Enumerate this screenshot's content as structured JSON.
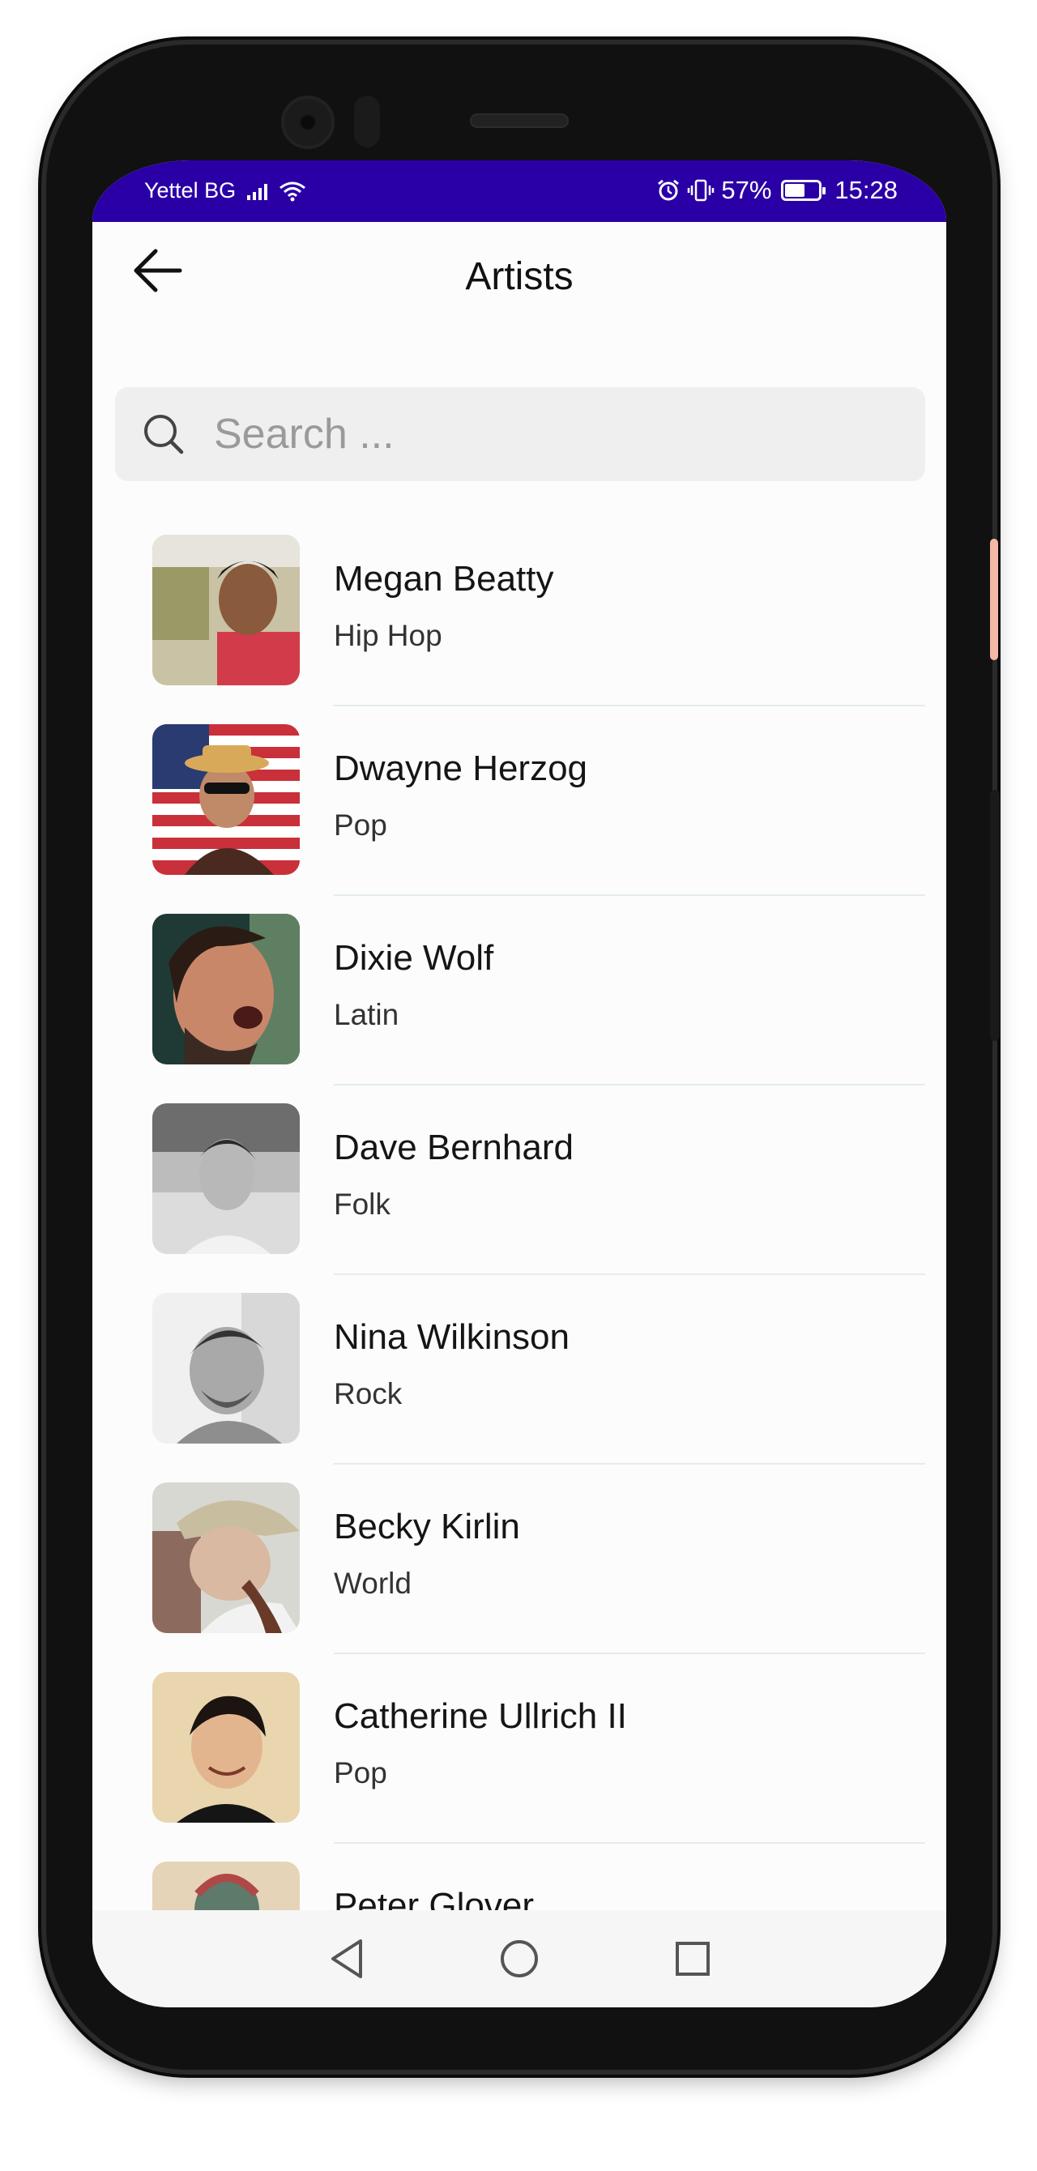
{
  "status_bar": {
    "carrier": "Yettel BG",
    "battery": "57%",
    "time": "15:28",
    "color": "#2a00a6"
  },
  "app_bar": {
    "title": "Artists",
    "back_icon": "arrow-left-icon"
  },
  "search": {
    "placeholder": "Search ...",
    "value": "",
    "icon": "search-icon"
  },
  "artists": [
    {
      "name": "Megan Beatty",
      "genre": "Hip Hop"
    },
    {
      "name": "Dwayne Herzog",
      "genre": "Pop"
    },
    {
      "name": "Dixie Wolf",
      "genre": "Latin"
    },
    {
      "name": "Dave Bernhard",
      "genre": "Folk"
    },
    {
      "name": "Nina Wilkinson",
      "genre": "Rock"
    },
    {
      "name": "Becky Kirlin",
      "genre": "World"
    },
    {
      "name": "Catherine Ullrich II",
      "genre": "Pop"
    },
    {
      "name": "Peter Glover",
      "genre": ""
    }
  ],
  "nav_bar": {
    "back": "triangle-back-icon",
    "home": "circle-home-icon",
    "recents": "square-recents-icon"
  }
}
